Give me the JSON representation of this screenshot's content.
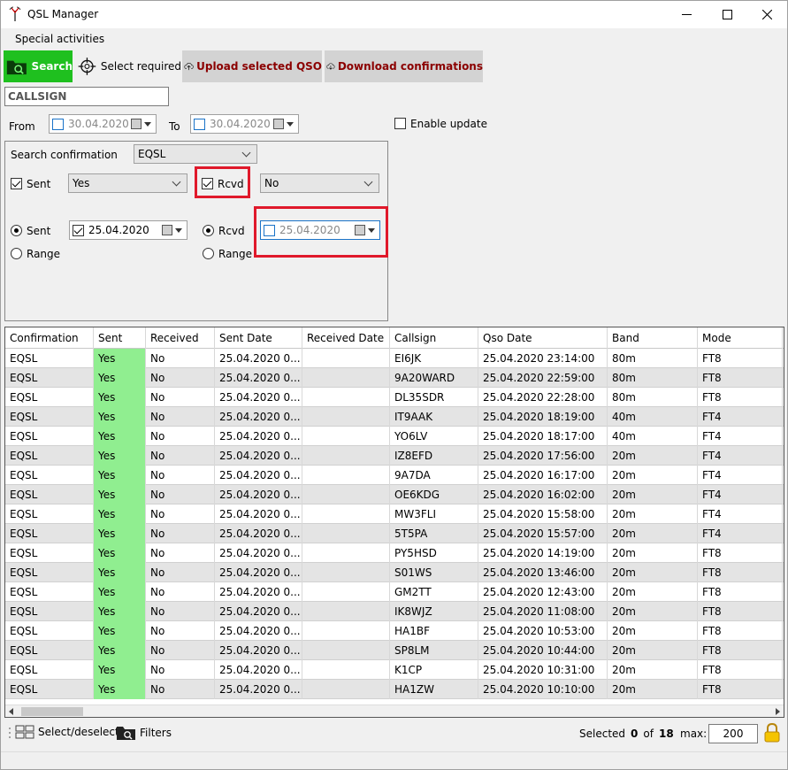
{
  "window": {
    "title": "QSL Manager"
  },
  "menu": {
    "special_activities": "Special activities"
  },
  "toolbar": {
    "search": "Search",
    "select_required": "Select required",
    "upload": "Upload selected QSO",
    "download": "Download confirmations"
  },
  "callsign": {
    "value": "CALLSIGN"
  },
  "filters": {
    "from_label": "From",
    "from_date": "30.04.2020",
    "to_label": "To",
    "to_date": "30.04.2020",
    "enable_update": "Enable update"
  },
  "search_group": {
    "confirmation_label": "Search confirmation",
    "confirmation_value": "EQSL",
    "sent_label": "Sent",
    "sent_value": "Yes",
    "rcvd_label": "Rcvd",
    "rcvd_value": "No",
    "sent_radio": "Sent",
    "sent_date": "25.04.2020",
    "range_left": "Range",
    "rcvd_radio": "Rcvd",
    "rcvd_date": "25.04.2020",
    "range_right": "Range"
  },
  "colors": {
    "search_green": "#1fc01f",
    "sent_cell": "#90ee90",
    "highlight_red": "#e0192b",
    "tool_red": "#8b0000"
  },
  "table": {
    "columns": [
      "Confirmation",
      "Sent",
      "Received",
      "Sent Date",
      "Received Date",
      "Callsign",
      "Qso Date",
      "Band",
      "Mode"
    ],
    "rows": [
      [
        "EQSL",
        "Yes",
        "No",
        "25.04.2020 0...",
        "",
        "EI6JK",
        "25.04.2020 23:14:00",
        "80m",
        "FT8"
      ],
      [
        "EQSL",
        "Yes",
        "No",
        "25.04.2020 0...",
        "",
        "9A20WARD",
        "25.04.2020 22:59:00",
        "80m",
        "FT8"
      ],
      [
        "EQSL",
        "Yes",
        "No",
        "25.04.2020 0...",
        "",
        "DL35SDR",
        "25.04.2020 22:28:00",
        "80m",
        "FT8"
      ],
      [
        "EQSL",
        "Yes",
        "No",
        "25.04.2020 0...",
        "",
        "IT9AAK",
        "25.04.2020 18:19:00",
        "40m",
        "FT4"
      ],
      [
        "EQSL",
        "Yes",
        "No",
        "25.04.2020 0...",
        "",
        "YO6LV",
        "25.04.2020 18:17:00",
        "40m",
        "FT4"
      ],
      [
        "EQSL",
        "Yes",
        "No",
        "25.04.2020 0...",
        "",
        "IZ8EFD",
        "25.04.2020 17:56:00",
        "20m",
        "FT4"
      ],
      [
        "EQSL",
        "Yes",
        "No",
        "25.04.2020 0...",
        "",
        "9A7DA",
        "25.04.2020 16:17:00",
        "20m",
        "FT4"
      ],
      [
        "EQSL",
        "Yes",
        "No",
        "25.04.2020 0...",
        "",
        "OE6KDG",
        "25.04.2020 16:02:00",
        "20m",
        "FT4"
      ],
      [
        "EQSL",
        "Yes",
        "No",
        "25.04.2020 0...",
        "",
        "MW3FLI",
        "25.04.2020 15:58:00",
        "20m",
        "FT4"
      ],
      [
        "EQSL",
        "Yes",
        "No",
        "25.04.2020 0...",
        "",
        "5T5PA",
        "25.04.2020 15:57:00",
        "20m",
        "FT4"
      ],
      [
        "EQSL",
        "Yes",
        "No",
        "25.04.2020 0...",
        "",
        "PY5HSD",
        "25.04.2020 14:19:00",
        "20m",
        "FT8"
      ],
      [
        "EQSL",
        "Yes",
        "No",
        "25.04.2020 0...",
        "",
        "S01WS",
        "25.04.2020 13:46:00",
        "20m",
        "FT8"
      ],
      [
        "EQSL",
        "Yes",
        "No",
        "25.04.2020 0...",
        "",
        "GM2TT",
        "25.04.2020 12:43:00",
        "20m",
        "FT8"
      ],
      [
        "EQSL",
        "Yes",
        "No",
        "25.04.2020 0...",
        "",
        "IK8WJZ",
        "25.04.2020 11:08:00",
        "20m",
        "FT8"
      ],
      [
        "EQSL",
        "Yes",
        "No",
        "25.04.2020 0...",
        "",
        "HA1BF",
        "25.04.2020 10:53:00",
        "20m",
        "FT8"
      ],
      [
        "EQSL",
        "Yes",
        "No",
        "25.04.2020 0...",
        "",
        "SP8LM",
        "25.04.2020 10:44:00",
        "20m",
        "FT8"
      ],
      [
        "EQSL",
        "Yes",
        "No",
        "25.04.2020 0...",
        "",
        "K1CP",
        "25.04.2020 10:31:00",
        "20m",
        "FT8"
      ],
      [
        "EQSL",
        "Yes",
        "No",
        "25.04.2020 0...",
        "",
        "HA1ZW",
        "25.04.2020 10:10:00",
        "20m",
        "FT8"
      ]
    ]
  },
  "status": {
    "select_deselect": "Select/deselect",
    "filters": "Filters",
    "selected_label": "Selected",
    "selected_count": "0",
    "of_label": "of",
    "total_count": "18",
    "max_label": "max:",
    "max_value": "200"
  }
}
